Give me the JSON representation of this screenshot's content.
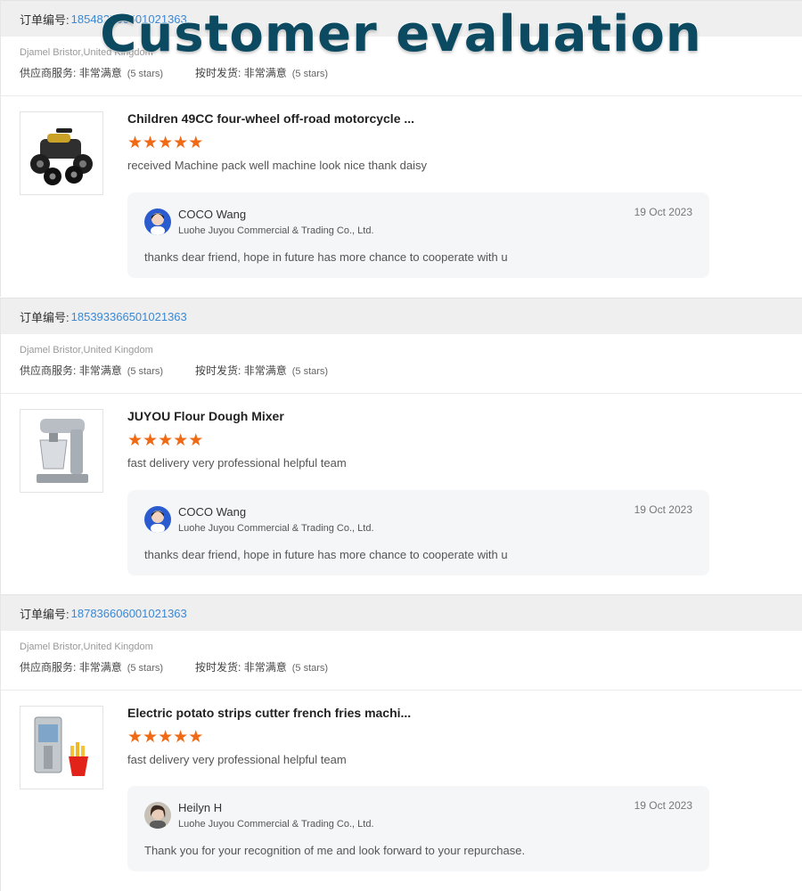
{
  "headline": "Customer evaluation",
  "labels": {
    "order_no": "订单编号:",
    "supplier_service": "供应商服务:",
    "on_time": "按时发货:",
    "very_satisfied": "非常满意",
    "five_stars": "(5 stars)"
  },
  "orders": [
    {
      "order_number": "185482766501021363",
      "buyer": "Djamel Bristor,United Kingdom",
      "product_title": "Children 49CC four-wheel off-road motorcycle ...",
      "rating": 5,
      "review": "received Machine pack well machine look nice  thank daisy",
      "reply": {
        "name": "COCO Wang",
        "company": "Luohe Juyou Commercial & Trading Co., Ltd.",
        "date": "19 Oct 2023",
        "text": "thanks dear friend,  hope in future has more chance  to cooperate with u"
      }
    },
    {
      "order_number": "185393366501021363",
      "buyer": "Djamel Bristor,United Kingdom",
      "product_title": "JUYOU Flour Dough Mixer",
      "rating": 5,
      "review": "fast delivery very professional helpful team",
      "reply": {
        "name": "COCO Wang",
        "company": "Luohe Juyou Commercial & Trading Co., Ltd.",
        "date": "19 Oct 2023",
        "text": "thanks dear friend,  hope in future has more chance  to cooperate with u"
      }
    },
    {
      "order_number": "187836606001021363",
      "buyer": "Djamel Bristor,United Kingdom",
      "product_title": "Electric potato strips cutter french fries machi...",
      "rating": 5,
      "review": "fast delivery very professional helpful team",
      "reply": {
        "name": "Heilyn H",
        "company": "Luohe Juyou Commercial & Trading Co., Ltd.",
        "date": "19 Oct 2023",
        "text": "Thank you for your recognition of me and look forward to your repurchase."
      }
    }
  ],
  "colors": {
    "accent_link": "#3a88d6",
    "star": "#f06a15",
    "headline": "#0b4a60"
  },
  "icons": [
    "atv-product-image",
    "dough-mixer-product-image",
    "fries-cutter-product-image",
    "star-icon",
    "avatar"
  ]
}
